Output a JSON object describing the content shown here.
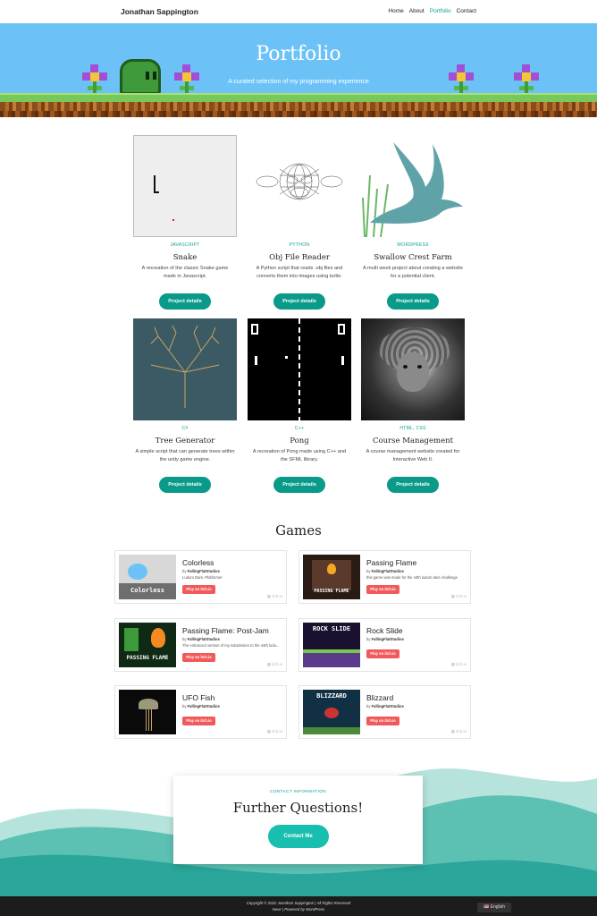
{
  "header": {
    "brand": "Jonathan Sappington",
    "nav": [
      {
        "label": "Home",
        "active": false
      },
      {
        "label": "About",
        "active": false
      },
      {
        "label": "Portfolio",
        "active": true
      },
      {
        "label": "Contact",
        "active": false
      }
    ]
  },
  "hero": {
    "title": "Portfolio",
    "subtitle": "A curated selection of my programming experience"
  },
  "projects": [
    {
      "category": "JAVASCRIPT",
      "title": "Snake",
      "desc": "A recreation of the classic Snake game made in Javascript.",
      "button": "Project details"
    },
    {
      "category": "PYTHON",
      "title": "Obj File Reader",
      "desc": "A Python script that reads .obj files and converts them into images using turtle.",
      "button": "Project details"
    },
    {
      "category": "WORDPRESS",
      "title": "Swallow Crest Farm",
      "desc": "A multi week project about creating a website for a potential client.",
      "button": "Project details"
    },
    {
      "category": "C#",
      "title": "Tree Generator",
      "desc": "A simple script that can generate trees within the unity game engine.",
      "button": "Project details"
    },
    {
      "category": "C++",
      "title": "Pong",
      "desc": "A recreation of Pong made using C++ and the SFML library.",
      "button": "Project details"
    },
    {
      "category": "HTML, CSS",
      "title": "Course Management",
      "desc": "A course management website created for Interactive Web II.",
      "button": "Project details"
    }
  ],
  "games_title": "Games",
  "games": [
    {
      "name": "Colorless",
      "by": "by",
      "author": "FallingFlatStudios",
      "desc": "Ludum Dare, Platformer",
      "button": "Play on itch.io",
      "badge": "itch.io",
      "thumb_text": "Colorless"
    },
    {
      "name": "Passing Flame",
      "by": "by",
      "author": "FallingFlatStudios",
      "desc": "this game was made for the 44th ludum dare challenge",
      "button": "Play on itch.io",
      "badge": "itch.io",
      "thumb_text": "PASSING FLAME"
    },
    {
      "name": "Passing Flame: Post-Jam",
      "by": "by",
      "author": "FallingFlatStudios",
      "desc": "The enhanced version of my submission to the 44th ludu...",
      "button": "Play on itch.io",
      "badge": "itch.io",
      "thumb_text": "PASSING FLAME"
    },
    {
      "name": "Rock Slide",
      "by": "by",
      "author": "FallingFlatStudios",
      "desc": "",
      "button": "Play on itch.io",
      "badge": "itch.io",
      "thumb_text": "ROCK SLIDE"
    },
    {
      "name": "UFO Fish",
      "by": "by",
      "author": "FallingFlatStudios",
      "desc": "",
      "button": "Play on itch.io",
      "badge": "itch.io",
      "thumb_text": ""
    },
    {
      "name": "Blizzard",
      "by": "by",
      "author": "FallingFlatStudios",
      "desc": "",
      "button": "Play on itch.io",
      "badge": "itch.io",
      "thumb_text": "BLIZZARD"
    }
  ],
  "contact": {
    "label": "CONTACT INFORMATION",
    "title": "Further Questions!",
    "button": "Contact Me"
  },
  "footer": {
    "line1": "Copyright © 2022 Jonathan Sappington | All Rights Reserved",
    "line2": "Neve | Powered by WordPress",
    "language": "English"
  },
  "colors": {
    "accent": "#0aa38f",
    "hero_sky": "#6cc2f7",
    "button": "#0a9a8a",
    "itch_button": "#f05a5a",
    "footer": "#1c1c1c"
  }
}
